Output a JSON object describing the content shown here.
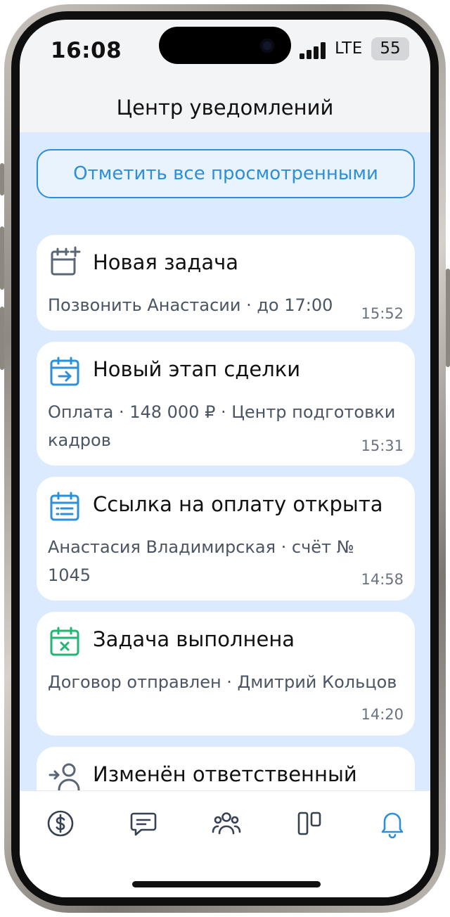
{
  "status_bar": {
    "time": "16:08",
    "network": "LTE",
    "battery": "55"
  },
  "header": {
    "title": "Центр уведомлений"
  },
  "actions": {
    "mark_all_read": "Отметить все просмотренными"
  },
  "notifications": [
    {
      "icon": "calendar-plus-icon",
      "title": "Новая задача",
      "description": "Позвонить Анастасии · до 17:00",
      "time": "15:52"
    },
    {
      "icon": "calendar-arrow-icon",
      "title": "Новый этап сделки",
      "description": "Оплата · 148 000 ₽ · Центр подготовки кадров",
      "time": "15:31"
    },
    {
      "icon": "calendar-list-icon",
      "title": "Ссылка на оплату открыта",
      "description": "Анастасия Владимирская · счёт № 1045",
      "time": "14:58"
    },
    {
      "icon": "calendar-check-icon",
      "title": "Задача выполнена",
      "description": "Договор отправлен · Дмитрий Кольцов",
      "time": "14:20"
    },
    {
      "icon": "user-arrow-icon",
      "title": "Изменён ответственный"
    }
  ],
  "tabs": [
    {
      "icon": "dollar-icon",
      "active": false
    },
    {
      "icon": "chat-icon",
      "active": false
    },
    {
      "icon": "contacts-icon",
      "active": false
    },
    {
      "icon": "kanban-icon",
      "active": false
    },
    {
      "icon": "bell-icon",
      "active": true
    }
  ],
  "colors": {
    "accent": "#2b8fd9",
    "success": "#22b573",
    "neutral_icon": "#5a6675",
    "content_bg": "#dbeafe",
    "card_bg": "#ffffff",
    "header_bg": "#f3f4f6"
  }
}
